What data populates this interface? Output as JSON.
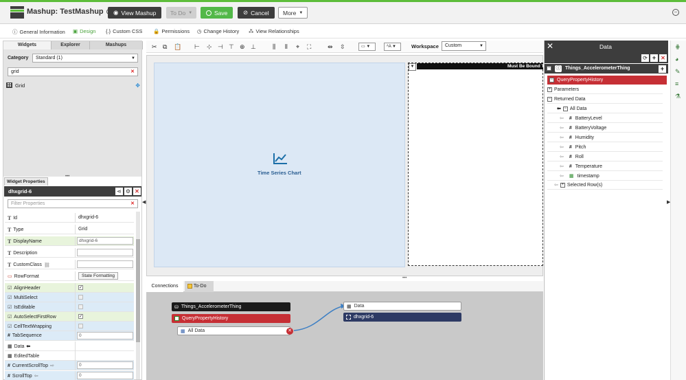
{
  "header": {
    "title": "Mashup: TestMashup",
    "view_mashup": "View Mashup",
    "todo": "To Do",
    "save": "Save",
    "cancel": "Cancel",
    "more": "More"
  },
  "tabs": [
    {
      "label": "General Information"
    },
    {
      "label": "Design"
    },
    {
      "label": "Custom CSS"
    },
    {
      "label": "Permissions"
    },
    {
      "label": "Change History"
    },
    {
      "label": "View Relationships"
    }
  ],
  "left": {
    "tabs": [
      "Widgets",
      "Explorer",
      "Mashups"
    ],
    "category_label": "Category",
    "category_value": "Standard (1)",
    "search_value": "grid",
    "widget_item": "Grid",
    "props_tab": "Widget Properties",
    "widget_name": "dhxgrid-6",
    "filter_placeholder": "Filter Properties",
    "props": [
      {
        "label": "Id",
        "value": "dhxgrid-6"
      },
      {
        "label": "Type",
        "value": "Grid"
      },
      {
        "label": "DisplayName",
        "value": "dhxgrid-6"
      },
      {
        "label": "Description",
        "value": ""
      },
      {
        "label": "CustomClass",
        "value": ""
      },
      {
        "label": "RowFormat",
        "value": "State Formatting"
      },
      {
        "label": "AlignHeader",
        "value": "✓"
      },
      {
        "label": "MultiSelect",
        "value": ""
      },
      {
        "label": "IsEditable",
        "value": ""
      },
      {
        "label": "AutoSelectFirstRow",
        "value": "✓"
      },
      {
        "label": "CellTextWrapping",
        "value": ""
      },
      {
        "label": "TabSequence",
        "value": "0"
      },
      {
        "label": "Data",
        "value": ""
      },
      {
        "label": "EditedTable",
        "value": ""
      },
      {
        "label": "CurrentScrollTop",
        "value": "0"
      },
      {
        "label": "ScrollTop",
        "value": "0"
      }
    ]
  },
  "toolbar": {
    "workspace_label": "Workspace",
    "workspace_value": "Custom"
  },
  "canvas": {
    "chart_label": "Time Series Chart",
    "grid_header": "Must Be Bound T"
  },
  "bottom": {
    "tabs": [
      "Connections",
      "To-Do"
    ],
    "nodes": {
      "thing": "Things_AccelerometerThing",
      "service": "QueryPropertyHistory",
      "alldata": "All Data",
      "data": "Data",
      "grid": "dhxgrid-6"
    }
  },
  "data_panel": {
    "title": "Data",
    "thing": "Things_AccelerometerThing",
    "service": "QueryPropertyHistory",
    "parameters": "Parameters",
    "returned": "Returned Data",
    "alldata": "All Data",
    "fields": [
      "BatteryLevel",
      "BatteryVoltage",
      "Humidity",
      "Pitch",
      "Roll",
      "Temperature",
      "timestamp"
    ],
    "selected_rows": "Selected Row(s)"
  },
  "colors": {
    "accent_green": "#5dbd3b",
    "service_red": "#c62f35",
    "dark": "#3d3d3d",
    "grid_node": "#2d3a64"
  }
}
